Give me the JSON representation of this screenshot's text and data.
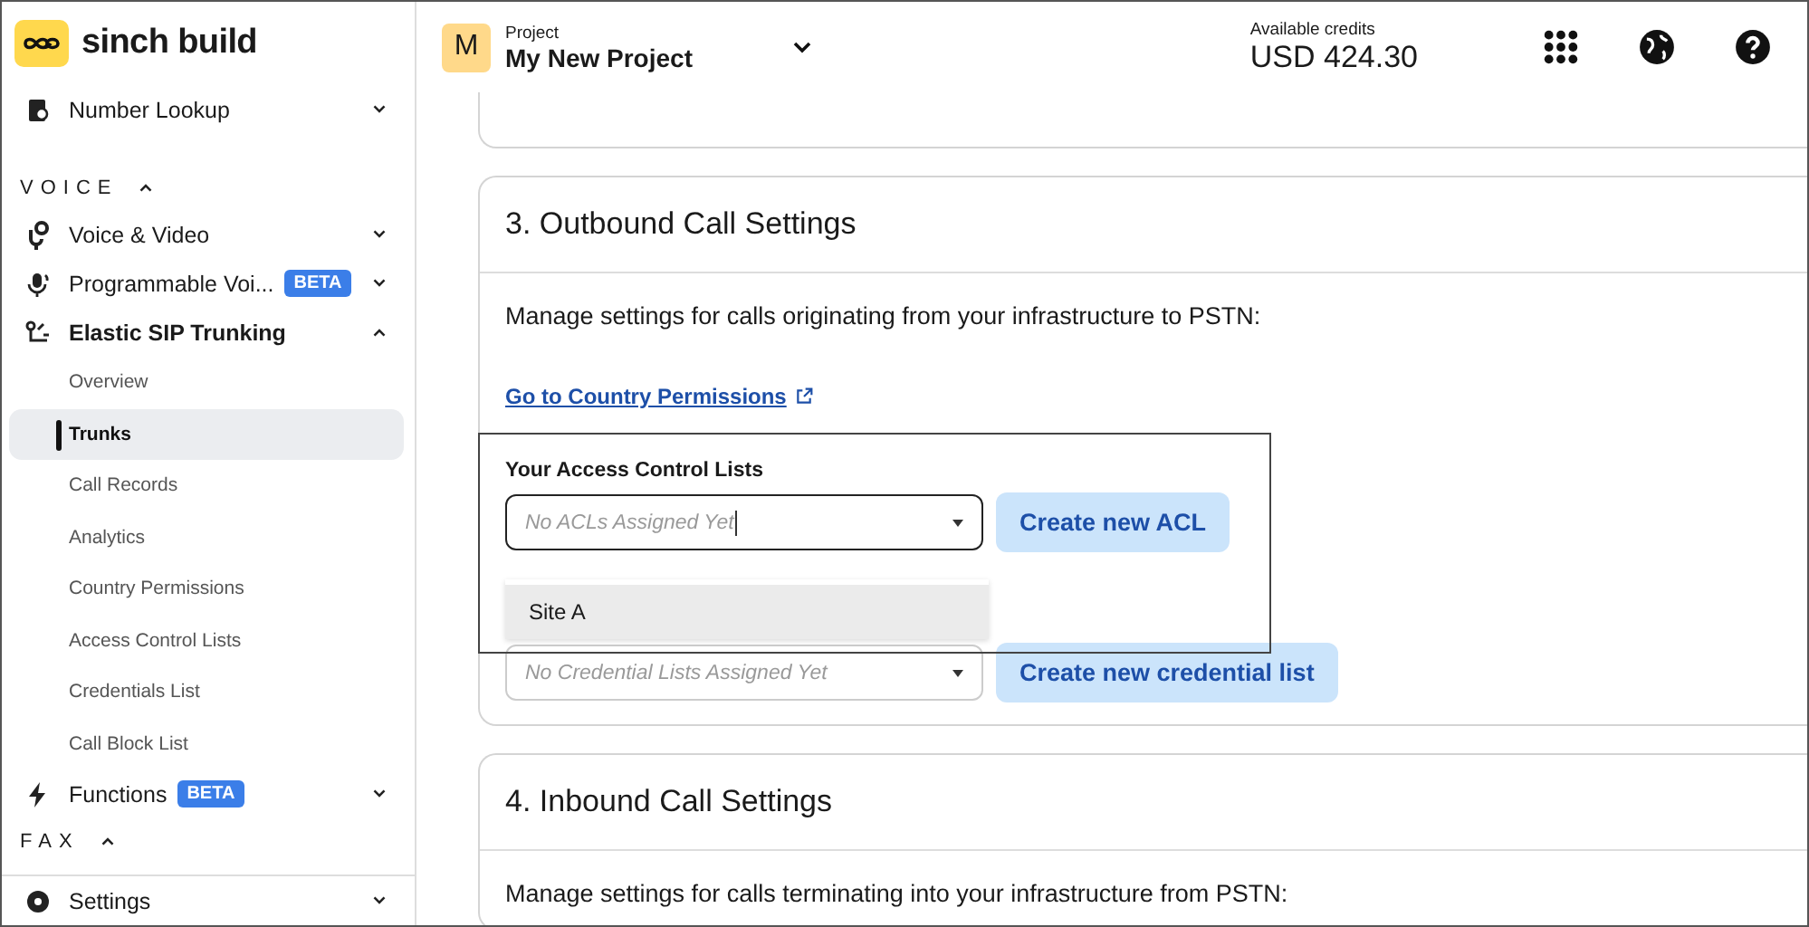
{
  "brand": {
    "name": "sinch build"
  },
  "sidebar": {
    "items": [
      {
        "kind": "item",
        "label": "Number Lookup",
        "expanded": false
      },
      {
        "kind": "section",
        "label": "VOICE",
        "expanded": true
      },
      {
        "kind": "item",
        "label": "Voice & Video",
        "expanded": false
      },
      {
        "kind": "item",
        "label": "Programmable Voi...",
        "badge": "BETA",
        "expanded": false
      },
      {
        "kind": "item",
        "label": "Elastic SIP Trunking",
        "expanded": true,
        "children": [
          {
            "label": "Overview",
            "selected": false
          },
          {
            "label": "Trunks",
            "selected": true
          },
          {
            "label": "Call Records",
            "selected": false
          },
          {
            "label": "Analytics",
            "selected": false
          },
          {
            "label": "Country Permissions",
            "selected": false
          },
          {
            "label": "Access Control Lists",
            "selected": false
          },
          {
            "label": "Credentials List",
            "selected": false
          },
          {
            "label": "Call Block List",
            "selected": false
          }
        ]
      },
      {
        "kind": "item",
        "label": "Functions",
        "badge": "BETA",
        "expanded": false
      },
      {
        "kind": "section",
        "label": "FAX",
        "expanded": true
      },
      {
        "kind": "item",
        "label": "Settings",
        "expanded": false
      }
    ]
  },
  "project": {
    "avatar": "M",
    "caption": "Project",
    "name": "My New Project"
  },
  "credits": {
    "caption": "Available credits",
    "amount": "USD 424.30"
  },
  "outbound": {
    "title": "3. Outbound Call Settings",
    "description": "Manage settings for calls originating from your infrastructure to PSTN:",
    "link": "Go to Country Permissions",
    "acl": {
      "label": "Your Access Control Lists",
      "placeholder": "No ACLs Assigned Yet",
      "button": "Create new ACL",
      "options": [
        {
          "label": "Site A"
        }
      ]
    },
    "credentials": {
      "placeholder": "No Credential Lists Assigned Yet",
      "button": "Create new credential list"
    }
  },
  "inbound": {
    "title": "4. Inbound Call Settings",
    "description": "Manage settings for calls terminating into your infrastructure from PSTN:"
  }
}
